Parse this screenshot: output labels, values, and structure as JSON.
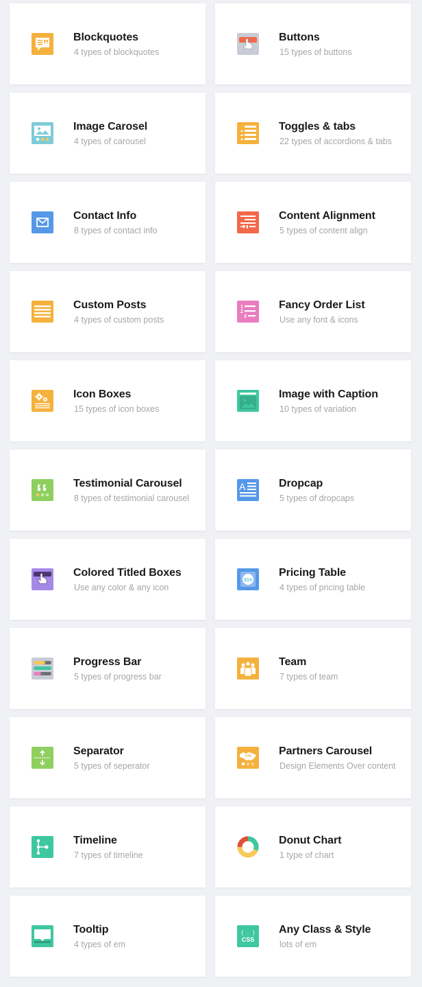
{
  "colors": {
    "page_background": "#f0f1f4",
    "card_background": "#ffffff",
    "title": "#1a1a1a",
    "subtitle": "#a6a6a6"
  },
  "elements": [
    {
      "title": "Blockquotes",
      "subtitle": "4 types of blockquotes",
      "icon": "blockquote-icon",
      "color": "#f5b13d"
    },
    {
      "title": "Buttons",
      "subtitle": "15 types of buttons",
      "icon": "button-click-icon",
      "color": "#c9ccd6"
    },
    {
      "title": "Image Carosel",
      "subtitle": "4 types of carousel",
      "icon": "image-carousel-icon",
      "color": "#7ecbd9"
    },
    {
      "title": "Toggles & tabs",
      "subtitle": "22 types of accordions & tabs",
      "icon": "toggles-list-icon",
      "color": "#f5b13d"
    },
    {
      "title": "Contact Info",
      "subtitle": "8 types of contact info",
      "icon": "envelope-icon",
      "color": "#5598e8"
    },
    {
      "title": "Content Alignment",
      "subtitle": "5 types of content align",
      "icon": "align-icon",
      "color": "#f26849"
    },
    {
      "title": "Custom Posts",
      "subtitle": "4 types of custom posts",
      "icon": "posts-lines-icon",
      "color": "#f5b13d"
    },
    {
      "title": "Fancy Order List",
      "subtitle": "Use any font & icons",
      "icon": "ordered-list-icon",
      "color": "#e97dbf"
    },
    {
      "title": "Icon Boxes",
      "subtitle": "15 types of icon boxes",
      "icon": "gears-icon",
      "color": "#f5b13d"
    },
    {
      "title": "Image with Caption",
      "subtitle": "10 types of variation",
      "icon": "image-caption-icon",
      "color": "#3fc7a0"
    },
    {
      "title": "Testimonial Carousel",
      "subtitle": "8 types of testimonial carousel",
      "icon": "quote-carousel-icon",
      "color": "#8fcf5f"
    },
    {
      "title": "Dropcap",
      "subtitle": "5 types of dropcaps",
      "icon": "dropcap-icon",
      "color": "#5598e8"
    },
    {
      "title": "Colored Titled Boxes",
      "subtitle": "Use any color & any icon",
      "icon": "titled-box-icon",
      "color": "#a688e6"
    },
    {
      "title": "Pricing Table",
      "subtitle": "4 types of pricing table",
      "icon": "price-tag-icon",
      "color": "#5598e8"
    },
    {
      "title": "Progress Bar",
      "subtitle": "5 types of progress bar",
      "icon": "progress-bars-icon",
      "color": "#c9ccd6"
    },
    {
      "title": "Team",
      "subtitle": "7 types of team",
      "icon": "team-icon",
      "color": "#f5b13d"
    },
    {
      "title": "Separator",
      "subtitle": "5 types of seperator",
      "icon": "separator-icon",
      "color": "#8fcf5f"
    },
    {
      "title": "Partners Carousel",
      "subtitle": "Design Elements Over content",
      "icon": "handshake-icon",
      "color": "#f5b13d"
    },
    {
      "title": "Timeline",
      "subtitle": "7 types of timeline",
      "icon": "timeline-icon",
      "color": "#3fc7a0"
    },
    {
      "title": "Donut Chart",
      "subtitle": "1 type of chart",
      "icon": "donut-chart-icon",
      "color": "#3fc7a0"
    },
    {
      "title": "Tooltip",
      "subtitle": "4 types of em",
      "icon": "tooltip-icon",
      "color": "#3fc7a0"
    },
    {
      "title": "Any Class & Style",
      "subtitle": "lots of em",
      "icon": "css-icon",
      "color": "#3fc7a0"
    }
  ],
  "icon_text": {
    "pricing": "$10",
    "dropcap": "A",
    "css_braces": "{ . }",
    "css": "CSS",
    "list_numbers": [
      "1",
      "2",
      "3"
    ]
  }
}
